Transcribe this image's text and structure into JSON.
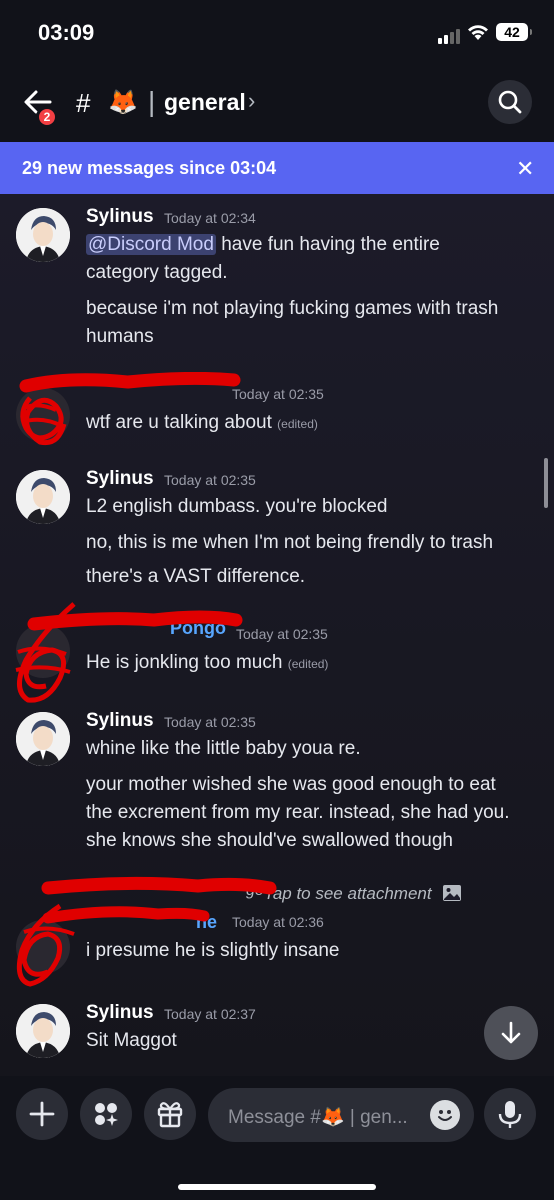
{
  "status_bar": {
    "time": "03:09",
    "battery": "42"
  },
  "header": {
    "back_badge": "2",
    "hash": "#",
    "channel_emoji": "🦊",
    "separator": "|",
    "channel_name": "general",
    "chevron": "›"
  },
  "banner": {
    "text": "29 new messages since 03:04",
    "close": "✕"
  },
  "messages": [
    {
      "author": "Sylinus",
      "time": "Today at 02:34",
      "mention": "@Discord Mod",
      "line1_rest": " have fun having the entire",
      "line2": "category tagged.",
      "line3": "because i'm not playing fucking games with trash",
      "line4": "humans"
    },
    {
      "author": "",
      "time": "Today at 02:35",
      "line1": "wtf are u talking about",
      "edited": "(edited)"
    },
    {
      "author": "Sylinus",
      "time": "Today at 02:35",
      "line1": "L2 english dumbass. you're blocked",
      "line2": "no, this is me when I'm not being frendly to trash",
      "line3": "there's a VAST difference."
    },
    {
      "author_fragment": "Pongo",
      "time": "Today at 02:35",
      "line1": "He is jonkling too much",
      "edited": "(edited)"
    },
    {
      "author": "Sylinus",
      "time": "Today at 02:35",
      "line1": "whine like the little baby youa re.",
      "line2": "your mother wished she was good enough to eat",
      "line3": "the excrement from my rear. instead, she had you.",
      "line4": "she knows she should've swallowed though"
    },
    {
      "reply_fragment": "go",
      "attachment": "Tap to see attachment",
      "author_fragment": "ne",
      "time": "Today at 02:36",
      "line1": "i presume he is slightly insane"
    },
    {
      "author": "Sylinus",
      "time": "Today at 02:37",
      "line1": "Sit Maggot"
    }
  ],
  "composer": {
    "placeholder": "Message #🦊 | gen..."
  },
  "colors": {
    "accent": "#5865f2",
    "mention_bg": "#3c4270",
    "username_blue": "#58a6ff",
    "redaction": "#e00000"
  },
  "icons": [
    "back-arrow-icon",
    "search-icon",
    "close-icon",
    "image-icon",
    "arrow-down-icon",
    "plus-icon",
    "apps-icon",
    "gift-icon",
    "emoji-icon",
    "microphone-icon"
  ]
}
